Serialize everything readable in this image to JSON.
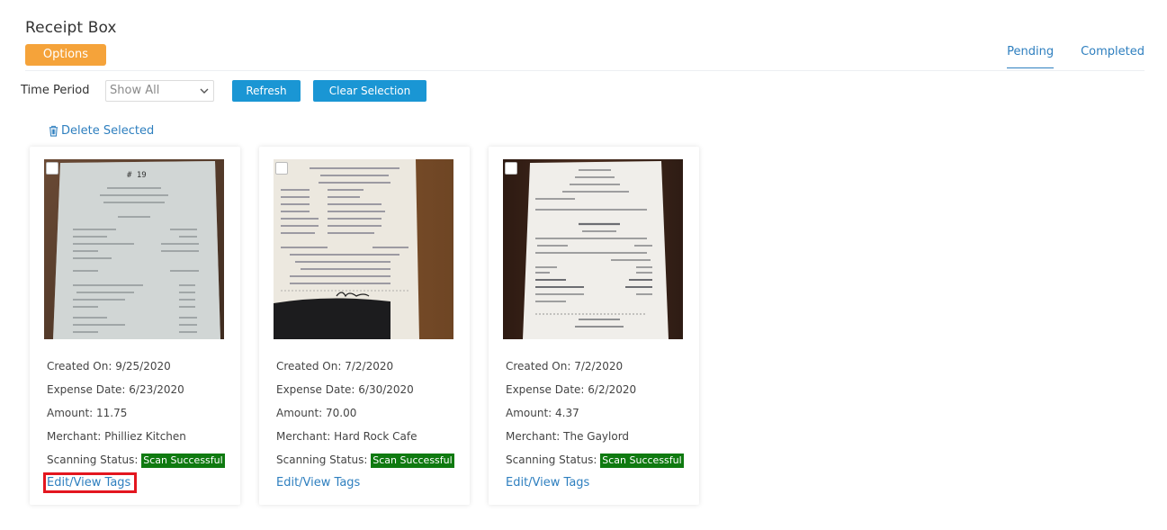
{
  "header": {
    "title": "Receipt Box",
    "options_label": "Options"
  },
  "tabs": [
    {
      "label": "Pending",
      "active": true
    },
    {
      "label": "Completed",
      "active": false
    }
  ],
  "filters": {
    "time_period_label": "Time Period",
    "time_period_value": "Show All",
    "refresh_label": "Refresh",
    "clear_selection_label": "Clear Selection",
    "delete_selected_label": "Delete Selected"
  },
  "colors": {
    "accent_orange": "#f5a33a",
    "primary_blue": "#1a96d4",
    "link_blue": "#2e7fbf",
    "success_green": "#0f7a10",
    "highlight_red": "#e3161f"
  },
  "receipts": [
    {
      "created_label": "Created On: 9/25/2020",
      "expense_label": "Expense Date: 6/23/2020",
      "amount_label": "Amount: 11.75",
      "merchant_label": "Merchant: Philliez Kitchen",
      "status_label": "Scanning Status:",
      "status_value": "Scan Successful",
      "edit_label": "Edit/View Tags",
      "highlighted": true
    },
    {
      "created_label": "Created On: 7/2/2020",
      "expense_label": "Expense Date:  6/30/2020",
      "amount_label": "Amount: 70.00",
      "merchant_label": "Merchant: Hard Rock Cafe",
      "status_label": "Scanning Status:",
      "status_value": "Scan Successful",
      "edit_label": "Edit/View Tags",
      "highlighted": false
    },
    {
      "created_label": "Created On: 7/2/2020",
      "expense_label": "Expense Date: 6/2/2020",
      "amount_label": "Amount: 4.37",
      "merchant_label": "Merchant: The Gaylord",
      "status_label": "Scanning Status:",
      "status_value": "Scan Successful",
      "edit_label": "Edit/View Tags",
      "highlighted": false
    }
  ]
}
